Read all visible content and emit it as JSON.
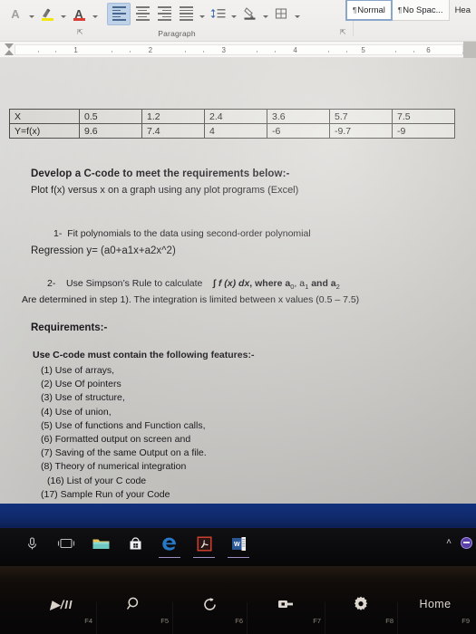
{
  "app": {
    "name": "Microsoft Word",
    "ribbon_group_label": "Paragraph",
    "dialog_launcher_glyph": "➘"
  },
  "ribbon": {
    "buttons": [
      {
        "name": "text-effects-icon",
        "label": "A"
      },
      {
        "name": "text-highlight-color-icon",
        "label": "ab"
      },
      {
        "name": "font-color-icon",
        "label": "A"
      },
      {
        "name": "align-left-icon",
        "label": "Align Left"
      },
      {
        "name": "align-center-icon",
        "label": "Center"
      },
      {
        "name": "align-right-icon",
        "label": "Align Right"
      },
      {
        "name": "justify-icon",
        "label": "Justify"
      },
      {
        "name": "line-spacing-icon",
        "label": "Line and Paragraph Spacing"
      },
      {
        "name": "shading-icon",
        "label": "Shading"
      },
      {
        "name": "borders-icon",
        "label": "Borders"
      }
    ],
    "styles": [
      {
        "name": "style-normal",
        "pilcrow": "¶",
        "label": "Normal",
        "active": true
      },
      {
        "name": "style-no-spacing",
        "pilcrow": "¶",
        "label": "No Spac...",
        "active": false
      },
      {
        "name": "style-heading",
        "pilcrow": "",
        "label": "Hea",
        "active": false
      }
    ]
  },
  "ruler": {
    "numbers": [
      "1",
      "2",
      "3",
      "4",
      "5",
      "6"
    ]
  },
  "document": {
    "table": {
      "rows": [
        {
          "label": "X",
          "values": [
            "0.5",
            "1.2",
            "2.4",
            "3.6",
            "5.7",
            "7.5"
          ]
        },
        {
          "label": "Y=f(x)",
          "values": [
            "9.6",
            "7.4",
            "4",
            "-6",
            "-9.7",
            "-9"
          ]
        }
      ]
    },
    "title": "Develop a C-code to meet the requirements below:-",
    "subtitle": "Plot f(x) versus x on a graph using any plot programs (Excel)",
    "task1": {
      "marker": "1-",
      "line1": "Fit polynomials to the data using second-order polynomial",
      "line2_prefix": "Regression y= (a0+a1x+a2x^2)"
    },
    "task2": {
      "marker": "2-",
      "line1_a": "Use Simpson’s Rule to calculate",
      "line1_integral": "∫ f (x) dx",
      "line1_b": ", where a",
      "line1_sub0": "0",
      "line1_c": ", a",
      "line1_sub1": "1",
      "line1_d": " and a",
      "line1_sub2": "2",
      "line2": "Are determined in step 1). The integration is limited between x values (0.5 – 7.5)"
    },
    "requirements_heading": "Requirements:-",
    "features_heading": "Use C-code must contain the following features:-",
    "features": [
      "(1) Use of arrays,",
      "(2) Use Of pointers",
      "(3) Use of structure,",
      "(4) Use of union,",
      "(5) Use of functions and Function calls,",
      "(6) Formatted output on screen and",
      "(7) Saving of the same Output on a file.",
      "(8) Theory of numerical integration",
      "(16) List of your C code",
      "(17) Sample Run of your Code"
    ]
  },
  "taskbar": {
    "items": [
      {
        "name": "cortana-microphone-icon",
        "label": "Cortana",
        "open": false
      },
      {
        "name": "task-view-icon",
        "label": "Task View",
        "open": false
      },
      {
        "name": "file-explorer-icon",
        "label": "File Explorer",
        "open": false
      },
      {
        "name": "microsoft-store-icon",
        "label": "Microsoft Store",
        "open": false
      },
      {
        "name": "microsoft-edge-icon",
        "label": "Microsoft Edge",
        "open": true
      },
      {
        "name": "adobe-acrobat-icon",
        "label": "Adobe Acrobat Reader",
        "open": true
      },
      {
        "name": "microsoft-word-icon",
        "label": "Microsoft Word",
        "open": true
      }
    ],
    "tray": {
      "show_hidden_icons": "˄",
      "notification_icon": "notification-icon"
    }
  },
  "keyboard": {
    "keys": [
      {
        "name": "play-pause-key",
        "glyph": "▶/II",
        "label": "F4"
      },
      {
        "name": "search-key",
        "glyph": "search",
        "label": "F5"
      },
      {
        "name": "refresh-key",
        "glyph": "refresh",
        "label": "F6"
      },
      {
        "name": "share-key",
        "glyph": "share",
        "label": "F7"
      },
      {
        "name": "settings-key",
        "glyph": "gear",
        "label": "F8"
      },
      {
        "name": "home-key",
        "glyph": "Home",
        "label": "F9"
      }
    ]
  },
  "colors": {
    "ribbon_bg": "#f2f1ef",
    "page_bg": "#d9d8d4",
    "wallpaper": "#12307c",
    "taskbar": "#0a0a0c",
    "selection_blue": "#bcd0e8",
    "highlight_yellow": "#f3e600",
    "font_red": "#d93025"
  }
}
